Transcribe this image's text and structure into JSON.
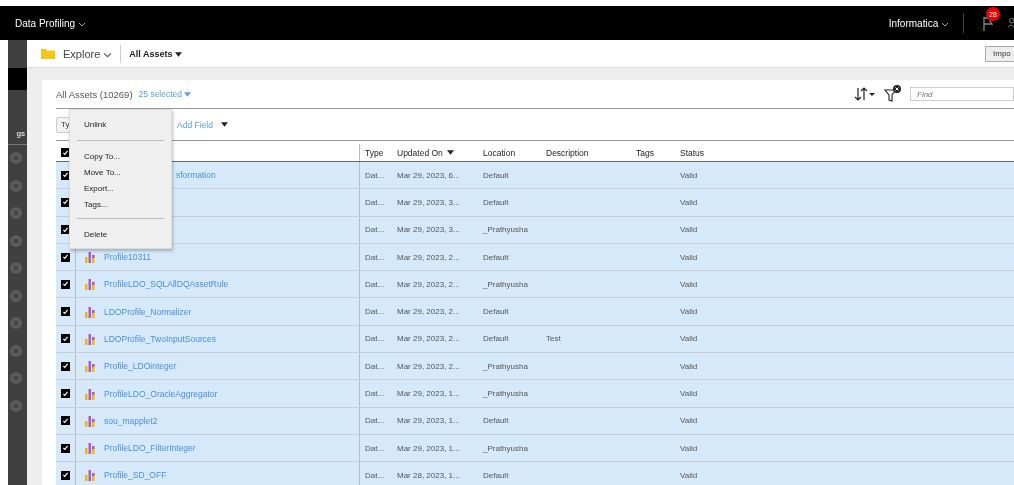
{
  "top_bar": {
    "app_name": "Data Profiling",
    "org": "Informatica",
    "notification_count": "28"
  },
  "toolbar": {
    "section": "Explore",
    "scope": "All Assets",
    "import_button": "Impo"
  },
  "sidebar": {
    "label": "gs"
  },
  "panel": {
    "title": "All Assets (10269)",
    "selection": "25 selected",
    "find_placeholder": "Find",
    "filter_chip": "Ty",
    "add_field": "Add Field"
  },
  "table": {
    "all_checked": true,
    "columns": [
      "Type",
      "Updated On",
      "Location",
      "Description",
      "Tags",
      "Status"
    ],
    "rows": [
      {
        "kind": "covered",
        "name": "sformation",
        "type": "Dat...",
        "updated": "Mar 29, 2023, 6...",
        "location": "Default",
        "description": "",
        "tags": "",
        "status": "Valid",
        "checked": true,
        "selected": true
      },
      {
        "kind": "covered",
        "name": "",
        "type": "Dat...",
        "updated": "Mar 29, 2023, 3...",
        "location": "Default",
        "description": "",
        "tags": "",
        "status": "Valid",
        "checked": true,
        "selected": true
      },
      {
        "kind": "covered",
        "name": "",
        "type": "Dat...",
        "updated": "Mar 29, 2023, 3...",
        "location": "_Prathyusha",
        "description": "",
        "tags": "",
        "status": "Valid",
        "checked": true,
        "selected": true
      },
      {
        "kind": "full",
        "name": "Profile10311",
        "type": "Dat...",
        "updated": "Mar 29, 2023, 2...",
        "location": "Default",
        "description": "",
        "tags": "",
        "status": "Valid",
        "checked": true,
        "selected": true
      },
      {
        "kind": "full",
        "name": "ProfileLDO_SQLAllDQAssetRule",
        "type": "Dat...",
        "updated": "Mar 29, 2023, 2...",
        "location": "_Prathyusha",
        "description": "",
        "tags": "",
        "status": "Valid",
        "checked": true,
        "selected": true
      },
      {
        "kind": "full",
        "name": "LDOProfile_Normalizer",
        "type": "Dat...",
        "updated": "Mar 29, 2023, 2...",
        "location": "Default",
        "description": "",
        "tags": "",
        "status": "Valid",
        "checked": true,
        "selected": true
      },
      {
        "kind": "full",
        "name": "LDOProfile_TwoInputSources",
        "type": "Dat...",
        "updated": "Mar 29, 2023, 2...",
        "location": "Default",
        "description": "Test",
        "tags": "",
        "status": "Valid",
        "checked": true,
        "selected": true
      },
      {
        "kind": "full",
        "name": "Profile_LDOinteger",
        "type": "Dat...",
        "updated": "Mar 29, 2023, 2...",
        "location": "_Prathyusha",
        "description": "",
        "tags": "",
        "status": "Valid",
        "checked": true,
        "selected": true
      },
      {
        "kind": "full",
        "name": "ProfileLDO_OracleAggregator",
        "type": "Dat...",
        "updated": "Mar 29, 2023, 1...",
        "location": "_Prathyusha",
        "description": "",
        "tags": "",
        "status": "Valid",
        "checked": true,
        "selected": true
      },
      {
        "kind": "full",
        "name": "sou_mapplet2",
        "type": "Dat...",
        "updated": "Mar 29, 2023, 1...",
        "location": "Default",
        "description": "",
        "tags": "",
        "status": "Valid",
        "checked": true,
        "selected": true
      },
      {
        "kind": "full",
        "name": "ProfileLDO_FilterInteger",
        "type": "Dat...",
        "updated": "Mar 29, 2023, 1...",
        "location": "_Prathyusha",
        "description": "",
        "tags": "",
        "status": "Valid",
        "checked": true,
        "selected": true
      },
      {
        "kind": "full",
        "name": "Profile_SD_OFF",
        "type": "Dat...",
        "updated": "Mar 28, 2023, 1...",
        "location": "Default",
        "description": "",
        "tags": "",
        "status": "Valid",
        "checked": true,
        "selected": true
      }
    ]
  },
  "context_menu": [
    {
      "kind": "item",
      "label": "Unlink"
    },
    {
      "kind": "separator"
    },
    {
      "kind": "item",
      "label": "Copy To..."
    },
    {
      "kind": "item",
      "label": "Move To..."
    },
    {
      "kind": "item",
      "label": "Export..."
    },
    {
      "kind": "item",
      "label": "Tags..."
    },
    {
      "kind": "separator"
    },
    {
      "kind": "item",
      "label": "Delete"
    }
  ]
}
